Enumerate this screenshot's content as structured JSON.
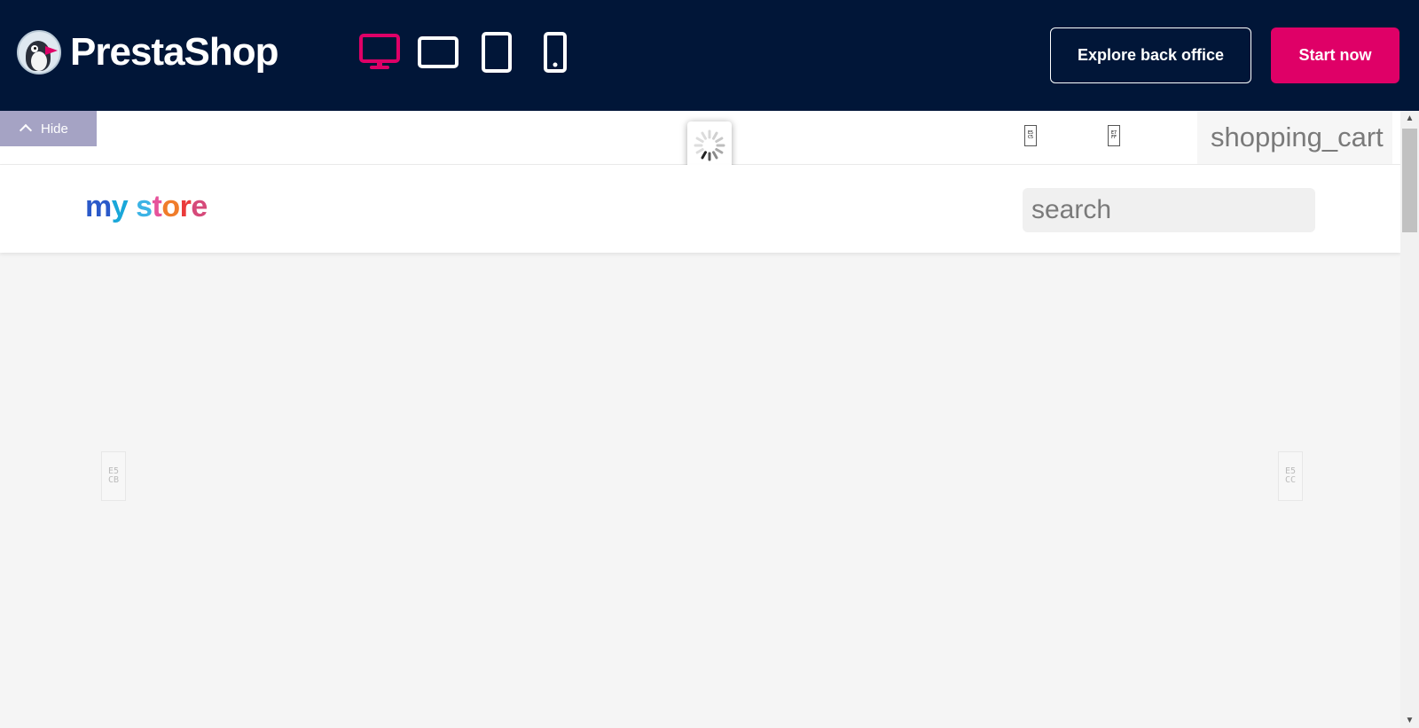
{
  "header": {
    "brand_name": "PrestaShop",
    "devices": [
      {
        "name": "desktop",
        "active": true
      },
      {
        "name": "tablet-landscape",
        "active": false
      },
      {
        "name": "tablet-portrait",
        "active": false
      },
      {
        "name": "mobile",
        "active": false
      }
    ],
    "explore_label": "Explore back office",
    "start_label": "Start now",
    "colors": {
      "background": "#011638",
      "accent": "#df0067",
      "text": "#ffffff"
    }
  },
  "store": {
    "hide_label": "Hide",
    "flag_1_glyph": "E5 C5",
    "flag_2_glyph": "E7 FF",
    "cart_label": "shopping_cart",
    "logo_text": "my store",
    "search": {
      "placeholder": "search",
      "value": ""
    },
    "arrow_left_glyph": "E5 CB",
    "arrow_right_glyph": "E5 CC",
    "loading": true
  }
}
